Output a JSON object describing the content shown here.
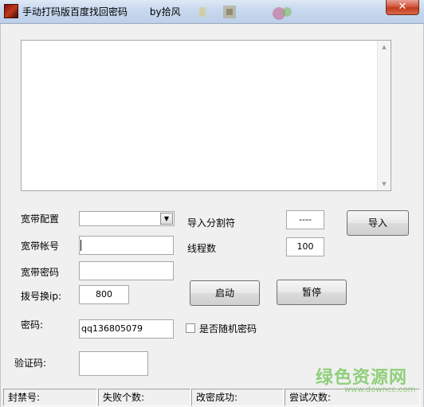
{
  "window": {
    "title": "手动打码版百度找回密码",
    "author": "by拾风",
    "close_glyph": "✕"
  },
  "form": {
    "broadband_config_label": "宽带配置",
    "broadband_config_value": "",
    "broadband_account_label": "宽带帐号",
    "broadband_account_value": "",
    "broadband_password_label": "宽带密码",
    "broadband_password_value": "",
    "dial_ip_label": "拨号换ip:",
    "dial_ip_value": "800",
    "import_separator_label": "导入分割符",
    "import_separator_value": "----",
    "thread_count_label": "线程数",
    "thread_count_value": "100",
    "password_label": "密码:",
    "password_value": "qq136805079",
    "random_password_label": "是否随机密码",
    "captcha_label": "验证码:",
    "captcha_value": ""
  },
  "buttons": {
    "import": "导入",
    "start": "启动",
    "pause": "暂停"
  },
  "status": {
    "banned": "封禁号:",
    "failed": "失败个数:",
    "changed": "改密成功:",
    "attempts": "尝试次数:"
  },
  "watermark": {
    "main": "绿色资源网",
    "sub": "www.downcc.com"
  },
  "colors": {
    "window_bg": "#f0f0f0",
    "titlebar": "#c9d9ee",
    "close_button": "#c23a1e",
    "watermark": "#8fcf7a"
  },
  "icons": {
    "app": "app-logo-icon",
    "dropdown": "chevron-down-icon",
    "scroll_up": "scroll-up-arrow-icon",
    "scroll_down": "scroll-down-arrow-icon"
  }
}
